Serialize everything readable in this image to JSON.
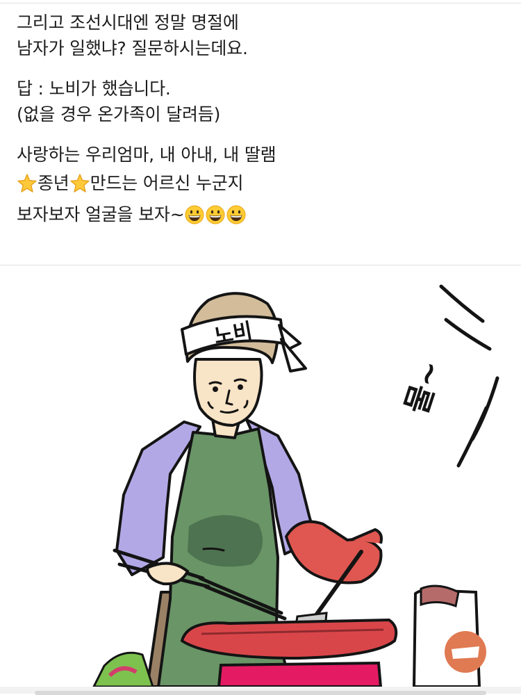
{
  "post": {
    "lines": [
      "그리고 조선시대엔 정말 명절에",
      "남자가 일했냐? 질문하시는데요.",
      "답 : 노비가 했습니다.",
      "(없을 경우 온가족이 달려듬)",
      "사랑하는 우리엄마, 내 아내, 내 딸램"
    ],
    "line6": {
      "part1": "종년",
      "part2": "만드는 어르신 누군지"
    },
    "line7": {
      "text": "보자보자 얼굴을 보자~"
    }
  },
  "illustration": {
    "headband_text": "노비",
    "sfx_text": "물~"
  },
  "colors": {
    "sleeve": "#b3a8e6",
    "apron": "#6a9567",
    "apron_shadow": "#4e7350",
    "skin": "#f8e4c6",
    "cap": "#d2bc9a",
    "mitt": "#df5750",
    "pan": "#d9464a",
    "stove": "#e41b63",
    "outline": "#141414"
  }
}
